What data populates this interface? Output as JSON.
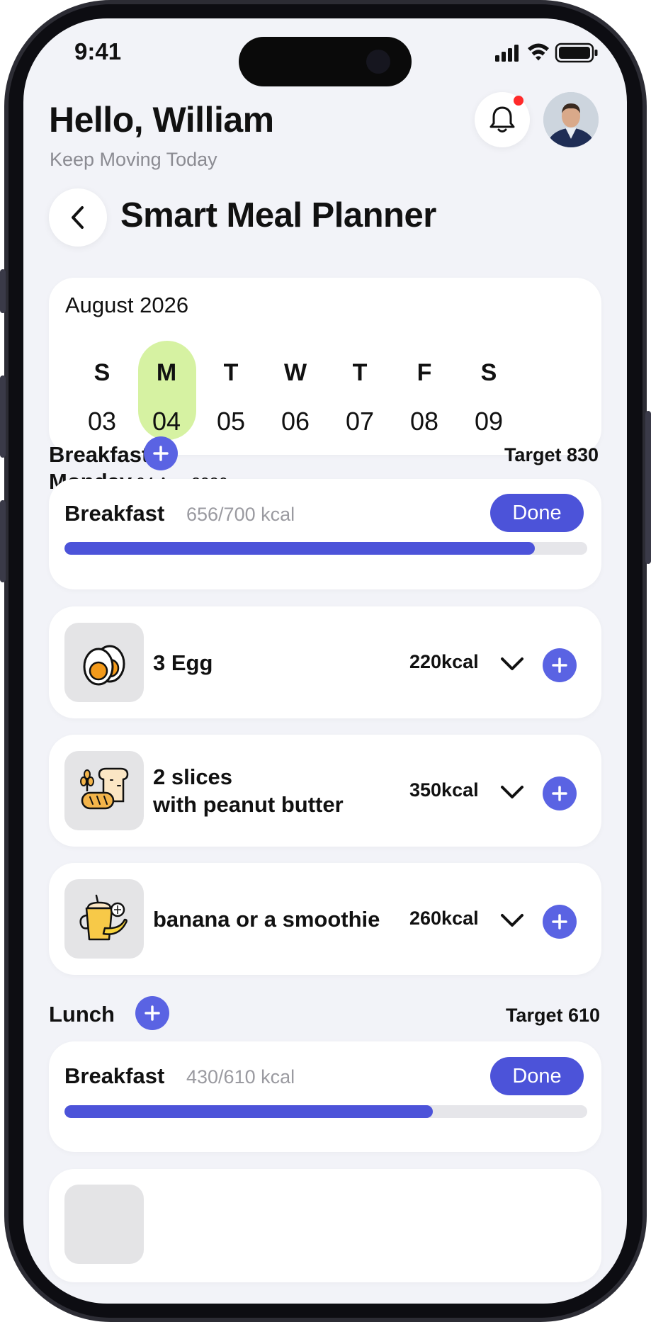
{
  "status_bar": {
    "time": "9:41"
  },
  "header": {
    "greeting": "Hello, William",
    "subtitle": "Keep Moving Today",
    "bell_icon": "bell-icon",
    "avatar": "user-avatar"
  },
  "page": {
    "title": "Smart Meal Planner",
    "back_icon": "chevron-left-icon"
  },
  "calendar": {
    "month": "August 2026",
    "days": [
      {
        "letter": "S",
        "num": "03",
        "selected": false
      },
      {
        "letter": "M",
        "num": "04",
        "selected": true
      },
      {
        "letter": "T",
        "num": "05",
        "selected": false
      },
      {
        "letter": "W",
        "num": "06",
        "selected": false
      },
      {
        "letter": "T",
        "num": "07",
        "selected": false
      },
      {
        "letter": "F",
        "num": "08",
        "selected": false
      },
      {
        "letter": "S",
        "num": "09",
        "selected": false
      }
    ],
    "selected_color": "#d6f2a2"
  },
  "day_heading": {
    "name": "Monday",
    "date": "04 Aug 2026"
  },
  "breakfast": {
    "title": "Breakfast",
    "target": "Target 830",
    "summary": {
      "title": "Breakfast",
      "kcal": "656/700 kcal",
      "done_label": "Done",
      "progress": 0.9
    },
    "items": [
      {
        "name": "3 Egg",
        "kcal": "220kcal",
        "icon": "egg-icon"
      },
      {
        "name_line1": "2 slices",
        "name_line2": "with peanut butter",
        "kcal": "350kcal",
        "icon": "bread-icon"
      },
      {
        "name": "banana or a smoothie",
        "kcal": "260kcal",
        "icon": "smoothie-icon"
      }
    ]
  },
  "lunch": {
    "title": "Lunch",
    "target": "Target 610",
    "summary": {
      "title": "Breakfast",
      "kcal": "430/610 kcal",
      "done_label": "Done",
      "progress": 0.705
    }
  },
  "colors": {
    "accent": "#4c53d9",
    "background": "#f2f3f8",
    "plus_button": "#5a63e3",
    "notification": "#ff2a2a"
  }
}
